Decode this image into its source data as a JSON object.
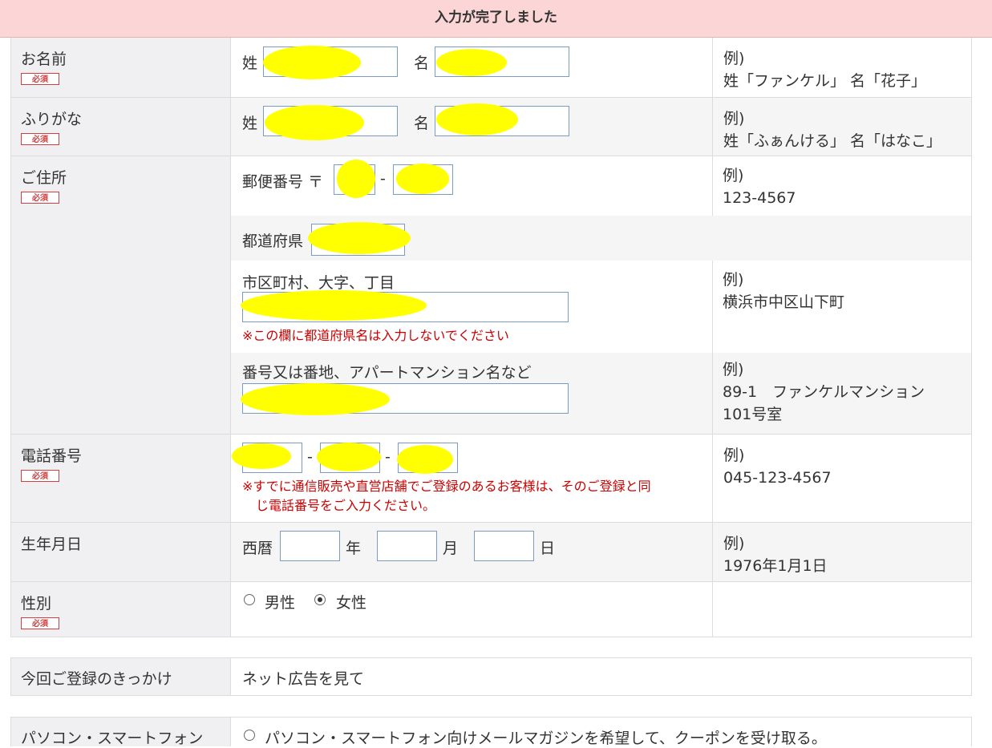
{
  "banner": {
    "text": "入力が完了しました"
  },
  "required_badge": "必須",
  "name": {
    "label": "お名前",
    "sei": "姓",
    "mei": "名",
    "example_title": "例)",
    "example": "姓「ファンケル」 名「花子」"
  },
  "furigana": {
    "label": "ふりがな",
    "sei": "姓",
    "mei": "名",
    "example_title": "例)",
    "example": "姓「ふぁんける」 名「はなこ」"
  },
  "address": {
    "label": "ご住所",
    "postal_label": "郵便番号 〒",
    "postal_dash": "-",
    "postal_example_title": "例)",
    "postal_example": "123-4567",
    "prefecture_label": "都道府県",
    "city_label": "市区町村、大字、丁目",
    "city_note": "※この欄に都道府県名は入力しないでください",
    "city_example_title": "例)",
    "city_example": "横浜市中区山下町",
    "street_label": "番号又は番地、アパートマンション名など",
    "street_example_title": "例)",
    "street_example_line1": "89-1　ファンケルマンション",
    "street_example_line2": "101号室"
  },
  "phone": {
    "label": "電話番号",
    "dash": "-",
    "note_line1": "※すでに通信販売や直営店舗でご登録のあるお客様は、そのご登録と同",
    "note_line2": "じ電話番号をご入力ください。",
    "example_title": "例)",
    "example": "045-123-4567"
  },
  "birthday": {
    "label": "生年月日",
    "era": "西暦",
    "year": "年",
    "month": "月",
    "day": "日",
    "example_title": "例)",
    "example": "1976年1月1日"
  },
  "gender": {
    "label": "性別",
    "options": [
      {
        "label": "男性",
        "selected": false
      },
      {
        "label": "女性",
        "selected": true
      }
    ]
  },
  "trigger": {
    "label": "今回ご登録のきっかけ",
    "value": "ネット広告を見て"
  },
  "pc_sp": {
    "label": "パソコン・スマートフォン",
    "option": "パソコン・スマートフォン向けメールマガジンを希望して、クーポンを受け取る。"
  },
  "colors": {
    "banner_bg": "#fcd6d6",
    "label_bg": "#f0f0f2",
    "alt_bg": "#f5f5f5",
    "required": "#d04040",
    "note": "#cc0000",
    "redaction": "#ffff00"
  }
}
